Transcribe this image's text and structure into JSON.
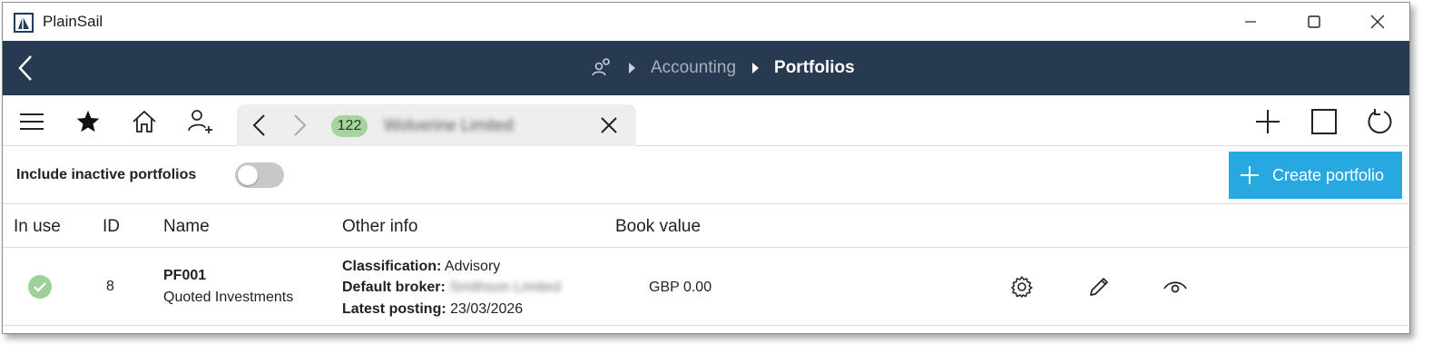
{
  "window": {
    "title": "PlainSail"
  },
  "breadcrumb": {
    "items": [
      "Accounting",
      "Portfolios"
    ]
  },
  "tab": {
    "badge": "122",
    "name": "Wolverine Limited"
  },
  "filter": {
    "label": "Include inactive portfolios",
    "include_inactive": false
  },
  "actions": {
    "create_label": "Create portfolio"
  },
  "table": {
    "headers": [
      "In use",
      "ID",
      "Name",
      "Other info",
      "Book value"
    ],
    "rows": [
      {
        "in_use": true,
        "id": "8",
        "code": "PF001",
        "name": "Quoted Investments",
        "classification_label": "Classification:",
        "classification": "Advisory",
        "broker_label": "Default broker:",
        "broker": "Smithson Limited",
        "posting_label": "Latest posting:",
        "posting": "23/03/2026",
        "book_value": "GBP 0.00"
      }
    ]
  },
  "colors": {
    "navbar": "#273a52",
    "accent": "#27a8e0",
    "badge": "#a6d39e",
    "check": "#9fd09a"
  }
}
